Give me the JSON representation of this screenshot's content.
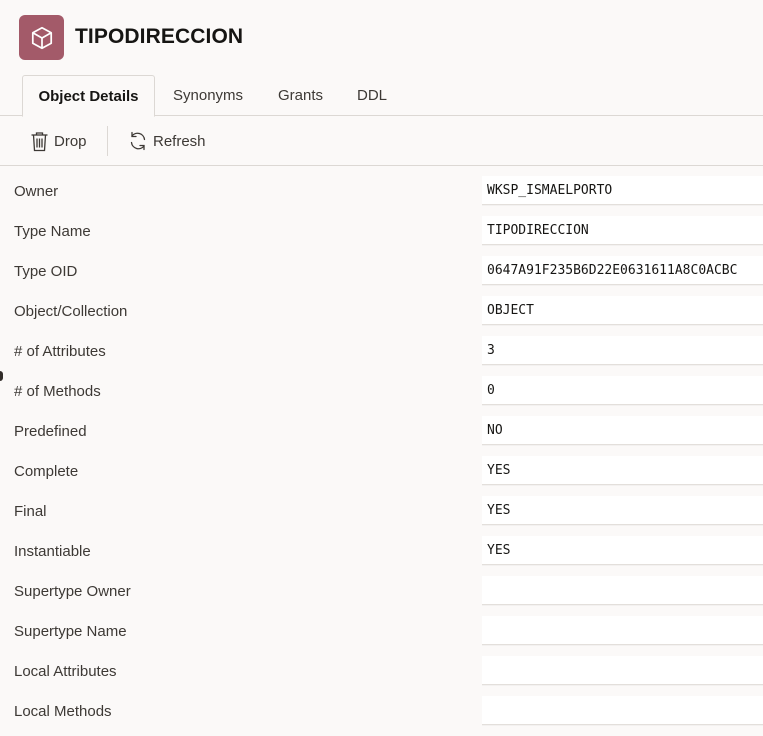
{
  "header": {
    "icon": "cube-icon",
    "icon_color": "#a35a69",
    "title": "TIPODIRECCION"
  },
  "tabs": [
    {
      "label": "Object Details",
      "active": true
    },
    {
      "label": "Synonyms",
      "active": false
    },
    {
      "label": "Grants",
      "active": false
    },
    {
      "label": "DDL",
      "active": false
    }
  ],
  "toolbar": {
    "drop": {
      "label": "Drop",
      "icon": "trash-icon"
    },
    "refresh": {
      "label": "Refresh",
      "icon": "refresh-icon"
    }
  },
  "details": [
    {
      "label": "Owner",
      "value": "WKSP_ISMAELPORTO"
    },
    {
      "label": "Type Name",
      "value": "TIPODIRECCION"
    },
    {
      "label": "Type OID",
      "value": "0647A91F235B6D22E0631611A8C0ACBC"
    },
    {
      "label": "Object/Collection",
      "value": "OBJECT"
    },
    {
      "label": "# of Attributes",
      "value": "3"
    },
    {
      "label": "# of Methods",
      "value": "0"
    },
    {
      "label": "Predefined",
      "value": "NO"
    },
    {
      "label": "Complete",
      "value": "YES"
    },
    {
      "label": "Final",
      "value": "YES"
    },
    {
      "label": "Instantiable",
      "value": "YES"
    },
    {
      "label": "Supertype Owner",
      "value": ""
    },
    {
      "label": "Supertype Name",
      "value": ""
    },
    {
      "label": "Local Attributes",
      "value": ""
    },
    {
      "label": "Local Methods",
      "value": ""
    }
  ]
}
